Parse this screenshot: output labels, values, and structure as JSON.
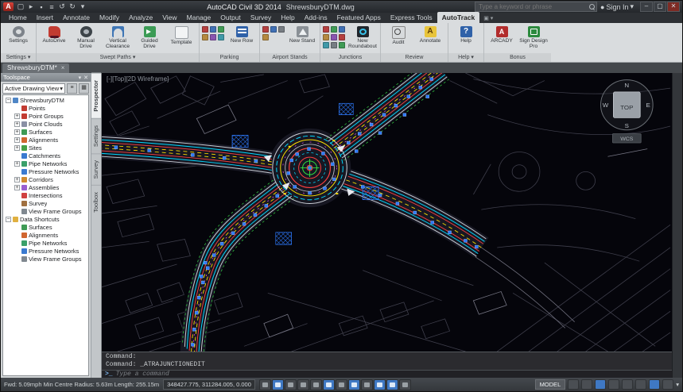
{
  "titlebar": {
    "logo_letter": "A",
    "app_title": "AutoCAD Civil 3D 2014",
    "doc_title": "ShrewsburyDTM.dwg",
    "search_placeholder": "Type a keyword or phrase",
    "signin_label": "Sign In"
  },
  "tabs": {
    "items": [
      {
        "label": "Home"
      },
      {
        "label": "Insert"
      },
      {
        "label": "Annotate"
      },
      {
        "label": "Modify"
      },
      {
        "label": "Analyze"
      },
      {
        "label": "View"
      },
      {
        "label": "Manage"
      },
      {
        "label": "Output"
      },
      {
        "label": "Survey"
      },
      {
        "label": "Help"
      },
      {
        "label": "Add-ins"
      },
      {
        "label": "Featured Apps"
      },
      {
        "label": "Express Tools"
      },
      {
        "label": "AutoTrack"
      }
    ],
    "active": "AutoTrack"
  },
  "ribbon": {
    "panels": [
      {
        "label": "Settings ▾",
        "buttons": [
          {
            "label": "Settings"
          }
        ]
      },
      {
        "label": "Swept Paths ▾",
        "buttons": [
          {
            "label": "AutoDrive"
          },
          {
            "label": "Manual Drive"
          },
          {
            "label": "Vertical Clearance"
          },
          {
            "label": "Guided Drive"
          },
          {
            "label": "Template"
          }
        ]
      },
      {
        "label": "Parking",
        "buttons": [
          {
            "label": "New Row"
          }
        ]
      },
      {
        "label": "Airport Stands",
        "buttons": [
          {
            "label": "New Stand"
          }
        ]
      },
      {
        "label": "Junctions",
        "buttons": [
          {
            "label": "New Roundabout"
          }
        ]
      },
      {
        "label": "Review",
        "buttons": [
          {
            "label": "Audit"
          },
          {
            "label": "Annotate"
          }
        ]
      },
      {
        "label": "Help ▾",
        "buttons": [
          {
            "label": "Help"
          }
        ]
      },
      {
        "label": "Bonus",
        "buttons": [
          {
            "label": "ARCADY"
          },
          {
            "label": "Sign Design Pro"
          }
        ]
      }
    ]
  },
  "filetab": {
    "label": "ShrewsburyDTM*",
    "close": "×"
  },
  "toolspace": {
    "title": "Toolspace",
    "view_selector": "Active Drawing View",
    "tree": [
      {
        "label": "ShrewsburyDTM"
      },
      {
        "label": "Points"
      },
      {
        "label": "Point Groups"
      },
      {
        "label": "Point Clouds"
      },
      {
        "label": "Surfaces"
      },
      {
        "label": "Alignments"
      },
      {
        "label": "Sites"
      },
      {
        "label": "Catchments"
      },
      {
        "label": "Pipe Networks"
      },
      {
        "label": "Pressure Networks"
      },
      {
        "label": "Corridors"
      },
      {
        "label": "Assemblies"
      },
      {
        "label": "Intersections"
      },
      {
        "label": "Survey"
      },
      {
        "label": "View Frame Groups"
      },
      {
        "label": "Data Shortcuts"
      },
      {
        "label": "Surfaces"
      },
      {
        "label": "Alignments"
      },
      {
        "label": "Pipe Networks"
      },
      {
        "label": "Pressure Networks"
      },
      {
        "label": "View Frame Groups"
      }
    ],
    "side_tabs": [
      {
        "label": "Prospector"
      },
      {
        "label": "Settings"
      },
      {
        "label": "Survey"
      },
      {
        "label": "Toolbox"
      }
    ]
  },
  "canvas": {
    "viewport_label": "[-][Top][2D Wireframe]",
    "viewcube": {
      "n": "N",
      "w": "W",
      "s": "S",
      "e": "E",
      "top": "TOP",
      "wcs": "WCS"
    }
  },
  "command": {
    "history1": "Command:",
    "history2": "Command: _ATRAJUNCTIONEDIT",
    "prompt_icon": ">_",
    "placeholder": "Type a command"
  },
  "statusbar": {
    "left_text": "Fwd: 5.09mph  Min Centre Radius: 5.63m  Length: 255.15m",
    "coords": "348427.775, 311284.005, 0.000",
    "model_label": "MODEL"
  }
}
